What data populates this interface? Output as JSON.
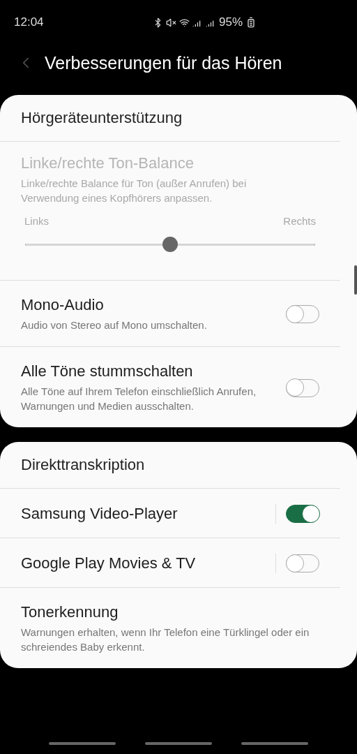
{
  "status_bar": {
    "time": "12:04",
    "battery": "95%"
  },
  "header": {
    "title": "Verbesserungen für das Hören"
  },
  "cards": [
    {
      "heading": "Hörgeräteunterstützung",
      "items": [
        {
          "kind": "slider",
          "title": "Linke/rechte Ton-Balance",
          "subtitle": "Linke/rechte Balance für Ton (außer Anrufen) bei Verwendung eines Kopfhörers anpassen.",
          "disabled": true,
          "left_label": "Links",
          "right_label": "Rechts",
          "level": 0.5
        },
        {
          "kind": "toggle",
          "title": "Mono-Audio",
          "subtitle": "Audio von Stereo auf Mono umschalten.",
          "on": false,
          "divider": false
        },
        {
          "kind": "toggle",
          "title": "Alle Töne stummschalten",
          "subtitle": "Alle Töne auf Ihrem Telefon einschließlich Anrufen, Warnungen und Medien ausschalten.",
          "on": false,
          "divider": false
        }
      ]
    },
    {
      "heading": "Direkttranskription",
      "items": [
        {
          "kind": "toggle",
          "title": "Samsung Video-Player",
          "on": true,
          "divider": true
        },
        {
          "kind": "toggle",
          "title": "Google Play Movies & TV",
          "on": false,
          "divider": true
        },
        {
          "kind": "text",
          "title": "Tonerkennung",
          "subtitle": "Warnungen erhalten, wenn Ihr Telefon eine Türklingel oder ein schreiendes Baby erkennt."
        }
      ]
    }
  ]
}
